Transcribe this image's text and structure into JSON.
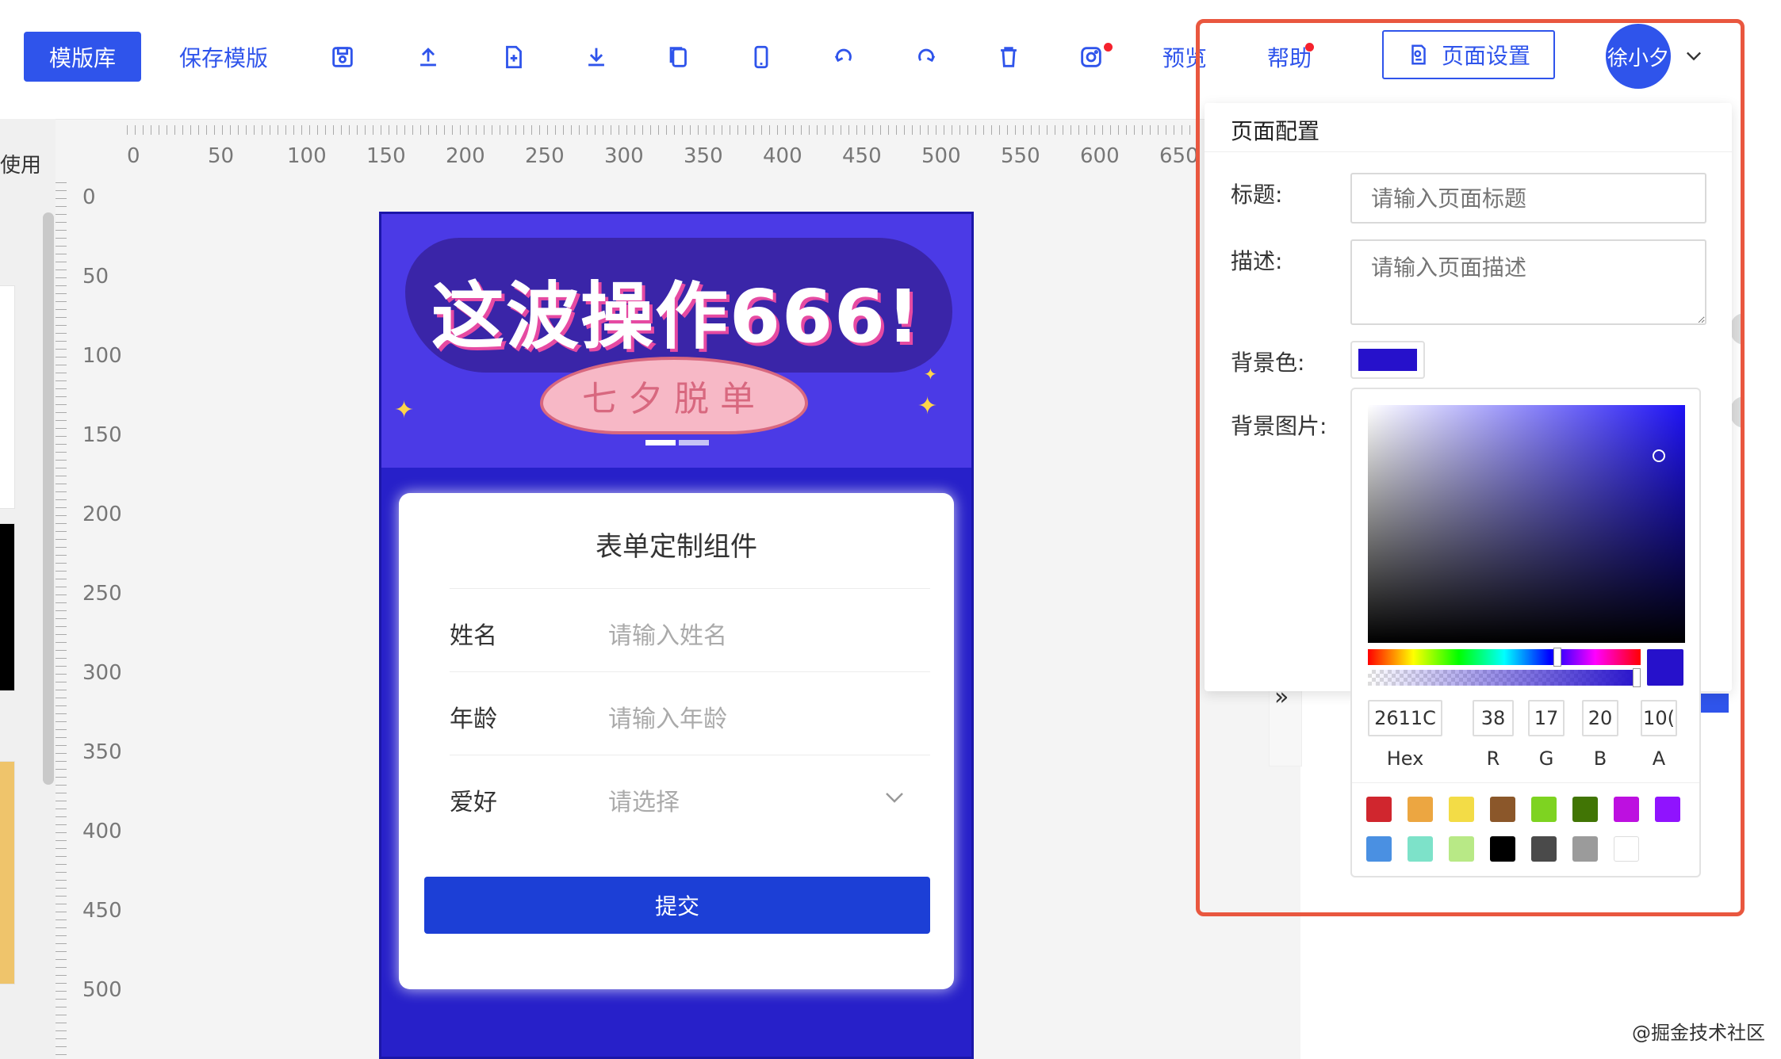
{
  "toolbar": {
    "template_lib": "模版库",
    "save_template": "保存模版",
    "preview": "预览",
    "help": "帮助",
    "page_settings": "页面设置",
    "user_name": "徐小夕"
  },
  "icons": [
    "save-icon",
    "upload-icon",
    "new-file-icon",
    "download-icon",
    "copy-icon",
    "mobile-icon",
    "undo-icon",
    "redo-icon",
    "delete-icon",
    "instagram-icon"
  ],
  "left": {
    "used_label": "使用"
  },
  "ruler": {
    "h": [
      "0",
      "50",
      "100",
      "150",
      "200",
      "250",
      "300",
      "350",
      "400",
      "450",
      "500",
      "550",
      "600",
      "650"
    ],
    "v": [
      "0",
      "50",
      "100",
      "150",
      "200",
      "250",
      "300",
      "350",
      "400",
      "450",
      "500"
    ]
  },
  "banner": {
    "title": "这波操作666!",
    "ribbon": "七夕脱单"
  },
  "form": {
    "title": "表单定制组件",
    "rows": [
      {
        "label": "姓名",
        "placeholder": "请输入姓名"
      },
      {
        "label": "年龄",
        "placeholder": "请输入年龄"
      },
      {
        "label": "爱好",
        "placeholder": "请选择"
      }
    ],
    "submit": "提交"
  },
  "config": {
    "header": "页面配置",
    "title_label": "标题:",
    "title_placeholder": "请输入页面标题",
    "desc_label": "描述:",
    "desc_placeholder": "请输入页面描述",
    "bg_color_label": "背景色:",
    "bg_image_label": "背景图片:"
  },
  "picker": {
    "hex": "2611C",
    "r": "38",
    "g": "17",
    "b": "20",
    "a": "10(",
    "labels": {
      "hex": "Hex",
      "r": "R",
      "g": "G",
      "b": "B",
      "a": "A"
    },
    "current_color": "#2611cb",
    "presets": [
      "#d0262e",
      "#eca641",
      "#f3dc46",
      "#8b572a",
      "#7ed321",
      "#417505",
      "#bd10e0",
      "#9013fe",
      "#4a90e2",
      "#7de2c9",
      "#b8e986",
      "#000000",
      "#4a4a4a",
      "#9b9b9b",
      "#ffffff"
    ]
  },
  "watermark": "@掘金技术社区"
}
